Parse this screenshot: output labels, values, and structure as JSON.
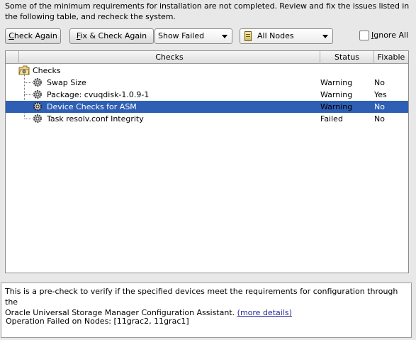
{
  "intro": {
    "line1": "Some of the minimum requirements for installation are not completed. Review and fix the issues listed in",
    "line2": "the following table, and recheck the system."
  },
  "toolbar": {
    "check_again_mn": "C",
    "check_again_rest": "heck Again",
    "fix_check_mn": "F",
    "fix_check_rest": "ix & Check Again",
    "show_filter": "Show Failed",
    "nodes_filter": "All Nodes",
    "ignore_all_mn": "I",
    "ignore_all_rest": "gnore All",
    "ignore_all_checked": false
  },
  "table": {
    "columns": {
      "checks": "Checks",
      "status": "Status",
      "fixable": "Fixable"
    },
    "root_label": "Checks",
    "rows": [
      {
        "check": "Swap Size",
        "status": "Warning",
        "fixable": "No",
        "selected": false
      },
      {
        "check": "Package: cvuqdisk-1.0.9-1",
        "status": "Warning",
        "fixable": "Yes",
        "selected": false
      },
      {
        "check": "Device Checks for ASM",
        "status": "Warning",
        "fixable": "No",
        "selected": true
      },
      {
        "check": "Task resolv.conf Integrity",
        "status": "Failed",
        "fixable": "No",
        "selected": false
      }
    ]
  },
  "details": {
    "line1": "This is a pre-check to verify if the specified devices meet the requirements for configuration through the",
    "line2_text": "Oracle Universal Storage Manager Configuration Assistant.",
    "more_link": "(more details)",
    "failed_nodes": "Operation Failed on Nodes: [11grac2, 11grac1]"
  },
  "colors": {
    "selection": "#2e5fb4",
    "link": "#2a2aa0",
    "background": "#e8e8e8"
  },
  "icons": {
    "root": "folder-icon",
    "check": "gear-icon",
    "nodes": "server-icon"
  }
}
